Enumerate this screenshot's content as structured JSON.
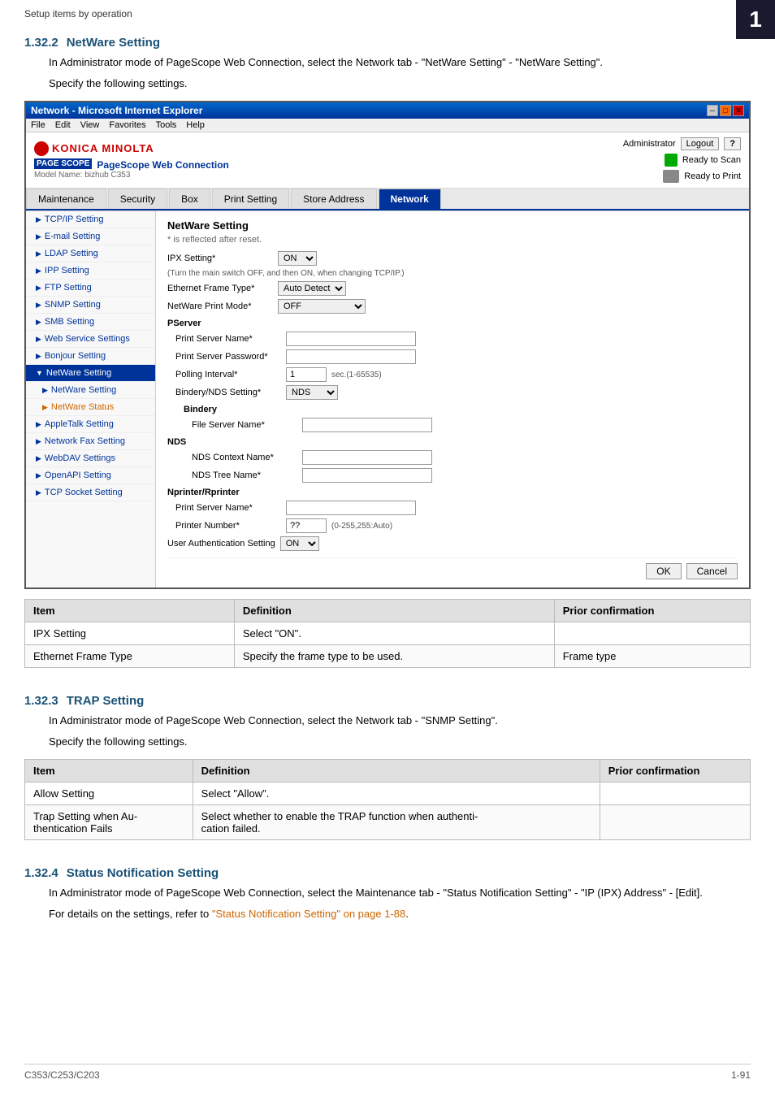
{
  "page": {
    "breadcrumb": "Setup items by operation",
    "page_number": "1",
    "footer_model": "C353/C253/C203",
    "footer_page": "1-91"
  },
  "section_132": {
    "number": "1.32.2",
    "title": "NetWare Setting",
    "desc1": "In Administrator mode of PageScope Web Connection, select the Network tab - \"NetWare Setting\" - \"NetWare Setting\".",
    "desc2": "Specify the following settings."
  },
  "browser": {
    "title": "Network - Microsoft Internet Explorer",
    "menu": [
      "File",
      "Edit",
      "View",
      "Favorites",
      "Tools",
      "Help"
    ],
    "admin_label": "Administrator",
    "logout_label": "Logout",
    "help_label": "?",
    "status1": "Ready to Scan",
    "status2": "Ready to Print",
    "model": "Model Name: bizhub C353",
    "brand": "KONICA MINOLTA",
    "pagescope": "PageScope Web Connection"
  },
  "nav_tabs": [
    {
      "label": "Maintenance",
      "active": false
    },
    {
      "label": "Security",
      "active": false
    },
    {
      "label": "Box",
      "active": false
    },
    {
      "label": "Print Setting",
      "active": false
    },
    {
      "label": "Store Address",
      "active": false
    },
    {
      "label": "Network",
      "active": true
    }
  ],
  "sidebar": {
    "items": [
      {
        "label": "TCP/IP Setting",
        "active": false
      },
      {
        "label": "E-mail Setting",
        "active": false
      },
      {
        "label": "LDAP Setting",
        "active": false
      },
      {
        "label": "IPP Setting",
        "active": false
      },
      {
        "label": "FTP Setting",
        "active": false
      },
      {
        "label": "SNMP Setting",
        "active": false
      },
      {
        "label": "SMB Setting",
        "active": false
      },
      {
        "label": "Web Service Settings",
        "active": false
      },
      {
        "label": "Bonjour Setting",
        "active": false
      },
      {
        "label": "NetWare Setting",
        "active": true,
        "expanded": true
      },
      {
        "label": "NetWare Setting",
        "active": false,
        "sub": true
      },
      {
        "label": "NetWare Status",
        "active": false,
        "sub": true
      },
      {
        "label": "AppleTalk Setting",
        "active": false
      },
      {
        "label": "Network Fax Setting",
        "active": false
      },
      {
        "label": "WebDAV Settings",
        "active": false
      },
      {
        "label": "OpenAPI Setting",
        "active": false
      },
      {
        "label": "TCP Socket Setting",
        "active": false
      }
    ]
  },
  "form": {
    "heading": "NetWare Setting",
    "note": "* is reflected after reset.",
    "ipx_label": "IPX Setting*",
    "ipx_value": "ON",
    "ipx_note": "(Turn the main switch OFF, and then ON, when changing TCP/IP.)",
    "ethernet_label": "Ethernet Frame Type*",
    "ethernet_value": "Auto Detect",
    "netware_mode_label": "NetWare Print Mode*",
    "netware_mode_value": "OFF",
    "pserver_label": "PServer",
    "print_server_name_label": "Print Server Name*",
    "print_server_name_value": "",
    "print_server_pwd_label": "Print Server Password*",
    "print_server_pwd_value": "",
    "polling_label": "Polling Interval*",
    "polling_value": "1",
    "polling_note": "sec.(1-65535)",
    "bindery_nds_label": "Bindery/NDS Setting*",
    "bindery_nds_value": "NDS",
    "bindery_label": "Bindery",
    "file_server_label": "File Server Name*",
    "file_server_value": "",
    "nds_label": "NDS",
    "nds_context_label": "NDS Context Name*",
    "nds_context_value": "",
    "nds_tree_label": "NDS Tree Name*",
    "nds_tree_value": "",
    "nprinter_label": "Nprinter/Rprinter",
    "nprinter_server_label": "Print Server Name*",
    "nprinter_server_value": "",
    "printer_number_label": "Printer Number*",
    "printer_number_value": "??",
    "printer_number_note": "(0-255,255:Auto)",
    "user_auth_label": "User Authentication Setting",
    "user_auth_value": "ON",
    "ok_label": "OK",
    "cancel_label": "Cancel"
  },
  "table1": {
    "headers": [
      "Item",
      "Definition",
      "Prior confirmation"
    ],
    "rows": [
      {
        "item": "IPX Setting",
        "definition": "Select \"ON\".",
        "prior": ""
      },
      {
        "item": "Ethernet Frame Type",
        "definition": "Specify the frame type to be used.",
        "prior": "Frame type"
      }
    ]
  },
  "section_133": {
    "number": "1.32.3",
    "title": "TRAP Setting",
    "desc1": "In Administrator mode of PageScope Web Connection, select the Network tab - \"SNMP Setting\".",
    "desc2": "Specify the following settings."
  },
  "table2": {
    "headers": [
      "Item",
      "Definition",
      "Prior confirmation"
    ],
    "rows": [
      {
        "item": "Allow Setting",
        "definition": "Select \"Allow\".",
        "prior": ""
      },
      {
        "item": "Trap Setting when Au-\nthentication Fails",
        "definition": "Select whether to enable the TRAP function when authenti-\ncation failed.",
        "prior": ""
      }
    ]
  },
  "section_134": {
    "number": "1.32.4",
    "title": "Status Notification Setting",
    "desc1": "In Administrator mode of PageScope Web Connection, select the Maintenance tab - \"Status Notification Setting\" - \"IP (IPX) Address\" - [Edit].",
    "desc2": "For details on the settings, refer to ",
    "link_text": "\"Status Notification Setting\" on page 1-88",
    "desc2_end": "."
  }
}
